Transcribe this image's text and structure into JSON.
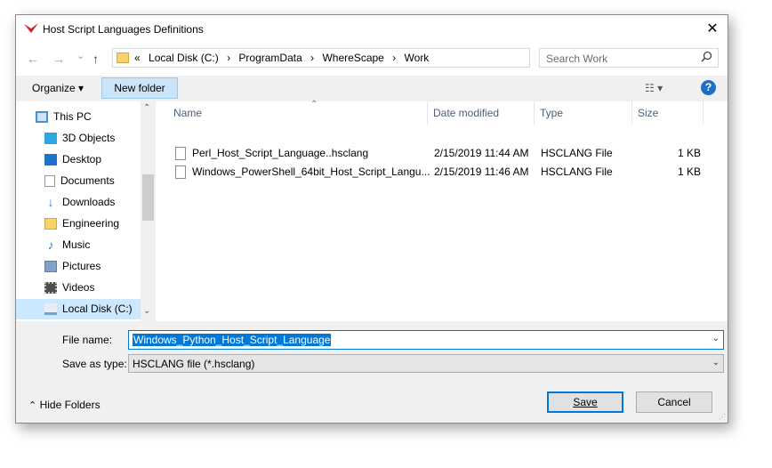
{
  "window": {
    "title": "Host Script Languages Definitions",
    "close_glyph": "✕",
    "app_icon": "wherescape-logo-icon"
  },
  "nav": {
    "back_glyph": "←",
    "forward_glyph": "→",
    "recent_glyph": "⌄",
    "up_glyph": "↑"
  },
  "address": {
    "overflow": "«",
    "crumbs": [
      "Local Disk (C:)",
      "ProgramData",
      "WhereScape",
      "Work"
    ],
    "separator": "›",
    "dropdown_glyph": "⌄",
    "refresh_glyph": "↻"
  },
  "search": {
    "placeholder": "Search Work",
    "icon": "search-icon"
  },
  "toolbar": {
    "organize_label": "Organize",
    "organize_caret": "▾",
    "new_folder_label": "New folder",
    "view_glyph": "☷ ▾",
    "help_glyph": "?"
  },
  "sidebar": {
    "items": [
      {
        "label": "This PC",
        "icon": "this-pc-icon",
        "color": "#4a8fd6"
      },
      {
        "label": "3D Objects",
        "icon": "3d-objects-icon",
        "color": "#2ea7e0"
      },
      {
        "label": "Desktop",
        "icon": "desktop-icon",
        "color": "#1e73c8"
      },
      {
        "label": "Documents",
        "icon": "documents-icon",
        "color": "#8a9bb0"
      },
      {
        "label": "Downloads",
        "icon": "downloads-icon",
        "color": "#2f7fd6"
      },
      {
        "label": "Engineering",
        "icon": "folder-icon",
        "color": "#f6d36b"
      },
      {
        "label": "Music",
        "icon": "music-icon",
        "color": "#2f7fd6"
      },
      {
        "label": "Pictures",
        "icon": "pictures-icon",
        "color": "#7fa3c6"
      },
      {
        "label": "Videos",
        "icon": "videos-icon",
        "color": "#4d4d4d"
      },
      {
        "label": "Local Disk (C:)",
        "icon": "local-disk-icon",
        "color": "#6fa6d8"
      }
    ],
    "selected_index": 9,
    "scroll_up_glyph": "⌃",
    "scroll_down_glyph": "⌄"
  },
  "files": {
    "sort_glyph": "⌃",
    "columns": [
      "Name",
      "Date modified",
      "Type",
      "Size"
    ],
    "rows": [
      {
        "name": "Perl_Host_Script_Language..hsclang",
        "date": "2/15/2019 11:44 AM",
        "type": "HSCLANG File",
        "size": "1 KB"
      },
      {
        "name": "Windows_PowerShell_64bit_Host_Script_Langu...",
        "date": "2/15/2019 11:46 AM",
        "type": "HSCLANG File",
        "size": "1 KB"
      }
    ]
  },
  "footer": {
    "file_name_label": "File name:",
    "file_name_value": "Windows_Python_Host_Script_Language",
    "save_as_type_label": "Save as type:",
    "save_as_type_value": "HSCLANG file (*.hsclang)",
    "dropdown_glyph": "⌄",
    "hide_folders_label": "Hide Folders",
    "hide_folders_glyph": "⌃",
    "save_label": "Save",
    "cancel_label": "Cancel",
    "grip_glyph": "⋰"
  },
  "colors": {
    "accent": "#0078d7",
    "selection": "#cce8ff",
    "new_folder_bg": "#cce4f7"
  }
}
